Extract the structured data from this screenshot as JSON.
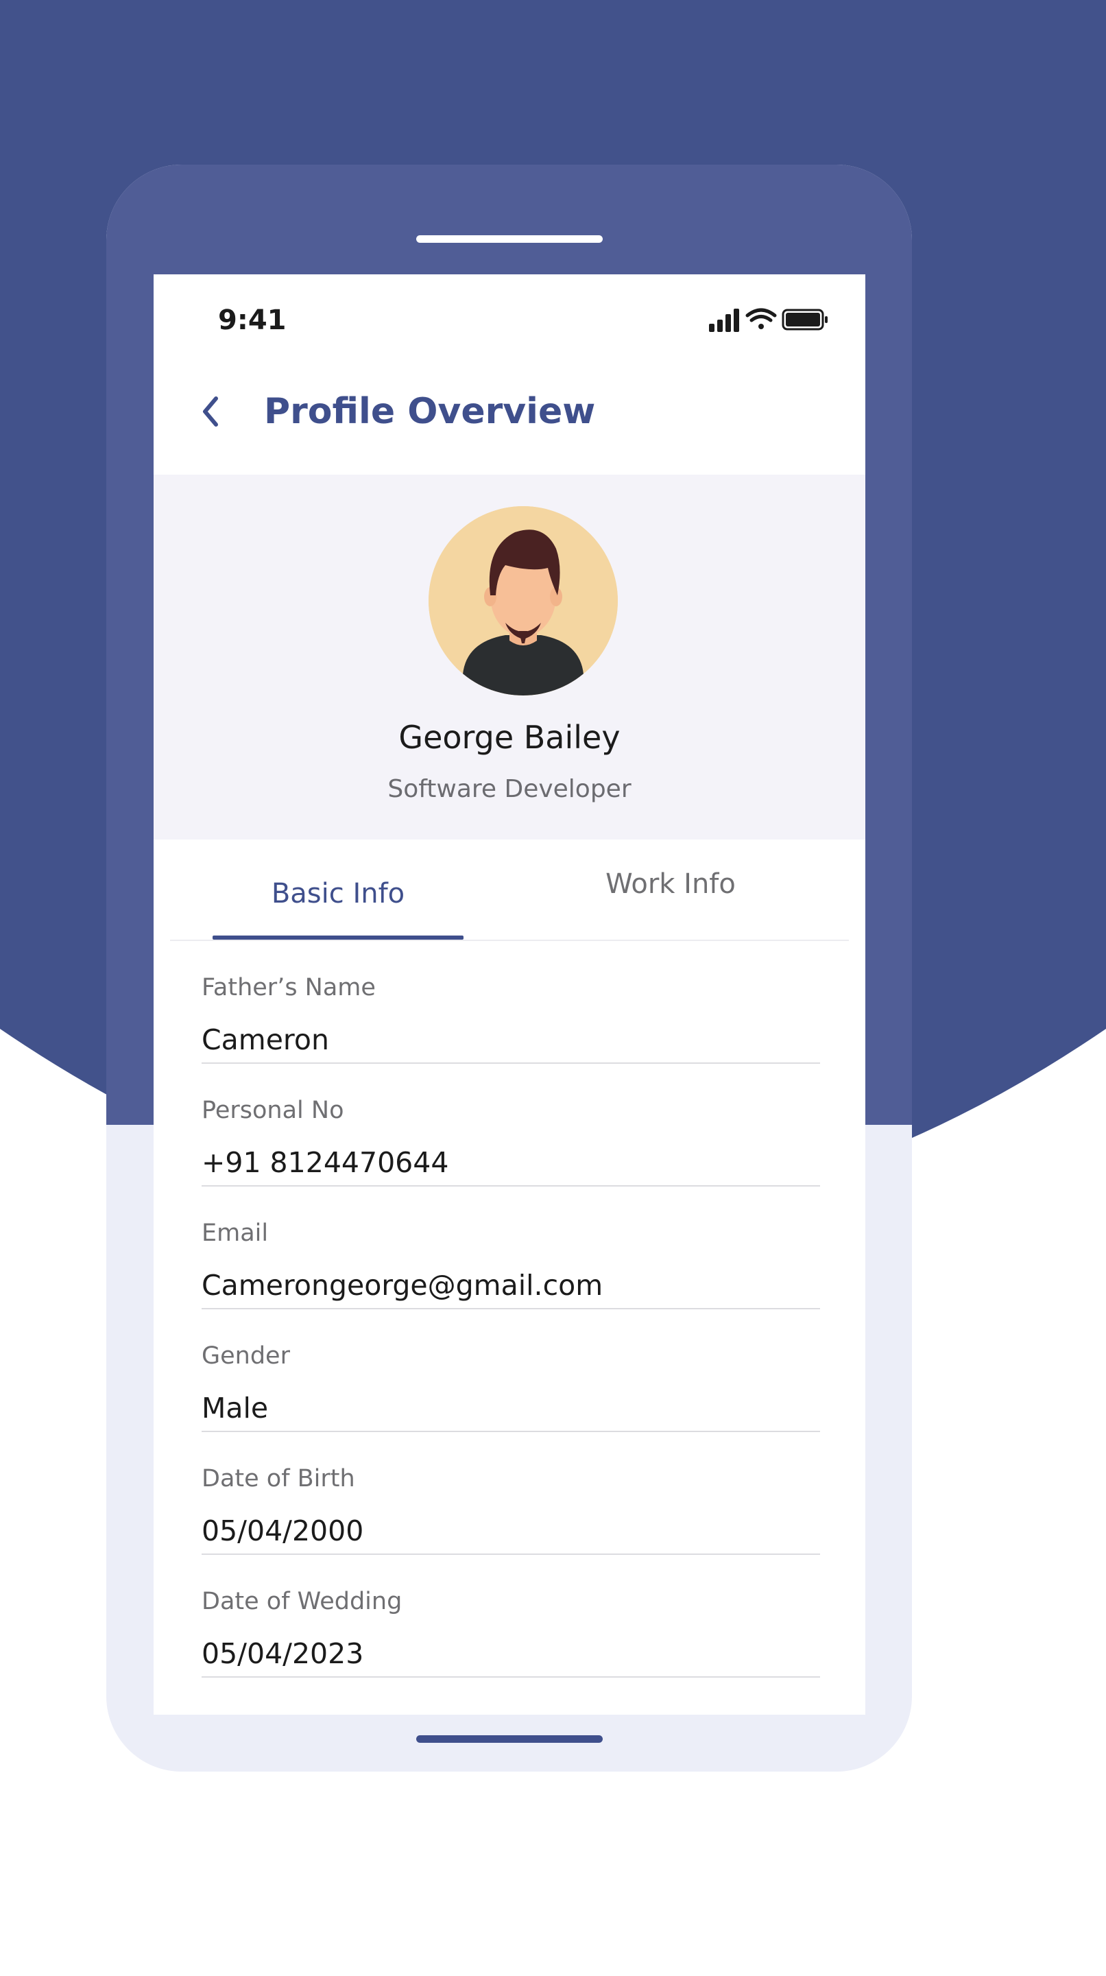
{
  "status_bar": {
    "time": "9:41",
    "icons": [
      "signal-icon",
      "wifi-icon",
      "battery-icon"
    ]
  },
  "header": {
    "back_icon": "chevron-left-icon",
    "title": "Profile Overview"
  },
  "profile": {
    "name": "George Bailey",
    "role": "Software Developer",
    "avatar_icon": "person-avatar-icon"
  },
  "tabs": [
    {
      "label": "Basic Info",
      "active": true
    },
    {
      "label": "Work Info",
      "active": false
    }
  ],
  "fields": [
    {
      "label": "Father’s Name",
      "value": "Cameron"
    },
    {
      "label": "Personal No",
      "value": "+91 8124470644"
    },
    {
      "label": "Email",
      "value": "Camerongeorge@gmail.com"
    },
    {
      "label": "Gender",
      "value": "Male"
    },
    {
      "label": "Date of Birth",
      "value": "05/04/2000"
    },
    {
      "label": "Date of Wedding",
      "value": "05/04/2023"
    }
  ],
  "colors": {
    "background_primary": "#3f4f8c",
    "phone_frame": "#505d96",
    "phone_frame_light": "#eceef8",
    "accent": "#3f4f8c",
    "profile_background": "#f4f3f9",
    "avatar_background": "#f4d6a1"
  }
}
